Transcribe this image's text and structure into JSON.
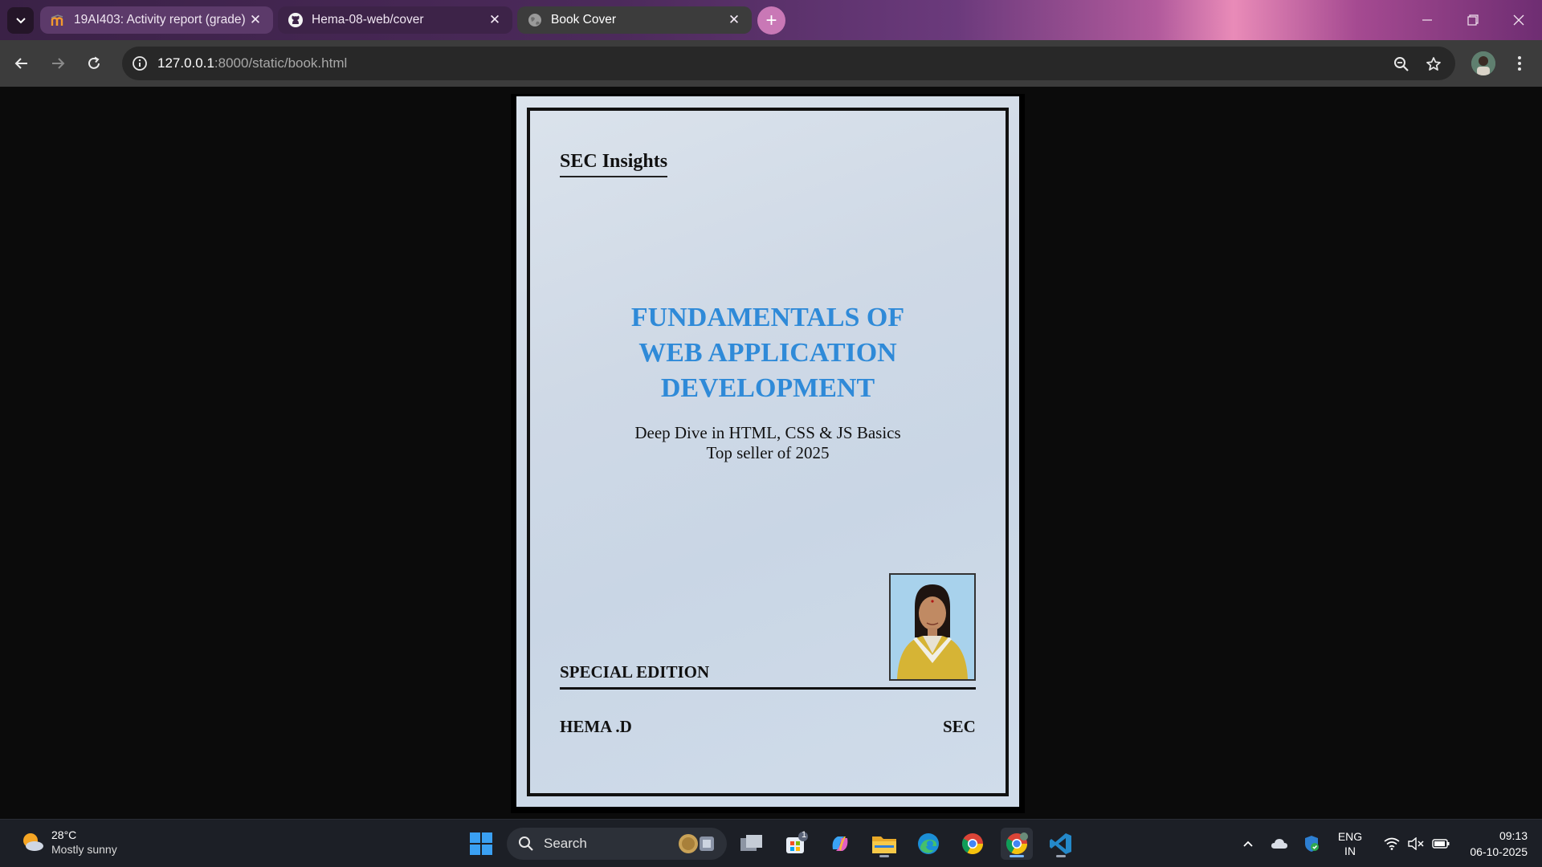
{
  "browser": {
    "tabs": [
      {
        "title": "19AI403: Activity report (grade)",
        "active": false
      },
      {
        "title": "Hema-08-web/cover",
        "active": false
      },
      {
        "title": "Book Cover",
        "active": true
      }
    ],
    "address": {
      "host": "127.0.0.1",
      "path": ":8000/static/book.html"
    }
  },
  "cover": {
    "brand": "SEC Insights",
    "title_lines": [
      "FUNDAMENTALS OF",
      "WEB APPLICATION",
      "DEVELOPMENT"
    ],
    "subtitle": "Deep Dive in HTML, CSS & JS Basics",
    "tagline": "Top seller of 2025",
    "edition": "SPECIAL EDITION",
    "author": "HEMA .D",
    "publisher": "SEC",
    "title_color": "#2f8ad8"
  },
  "taskbar": {
    "weather": {
      "temp": "28°C",
      "condition": "Mostly sunny"
    },
    "search_label": "Search",
    "store_badge": "1",
    "language": {
      "line1": "ENG",
      "line2": "IN"
    },
    "clock": {
      "time": "09:13",
      "date": "06-10-2025"
    }
  }
}
